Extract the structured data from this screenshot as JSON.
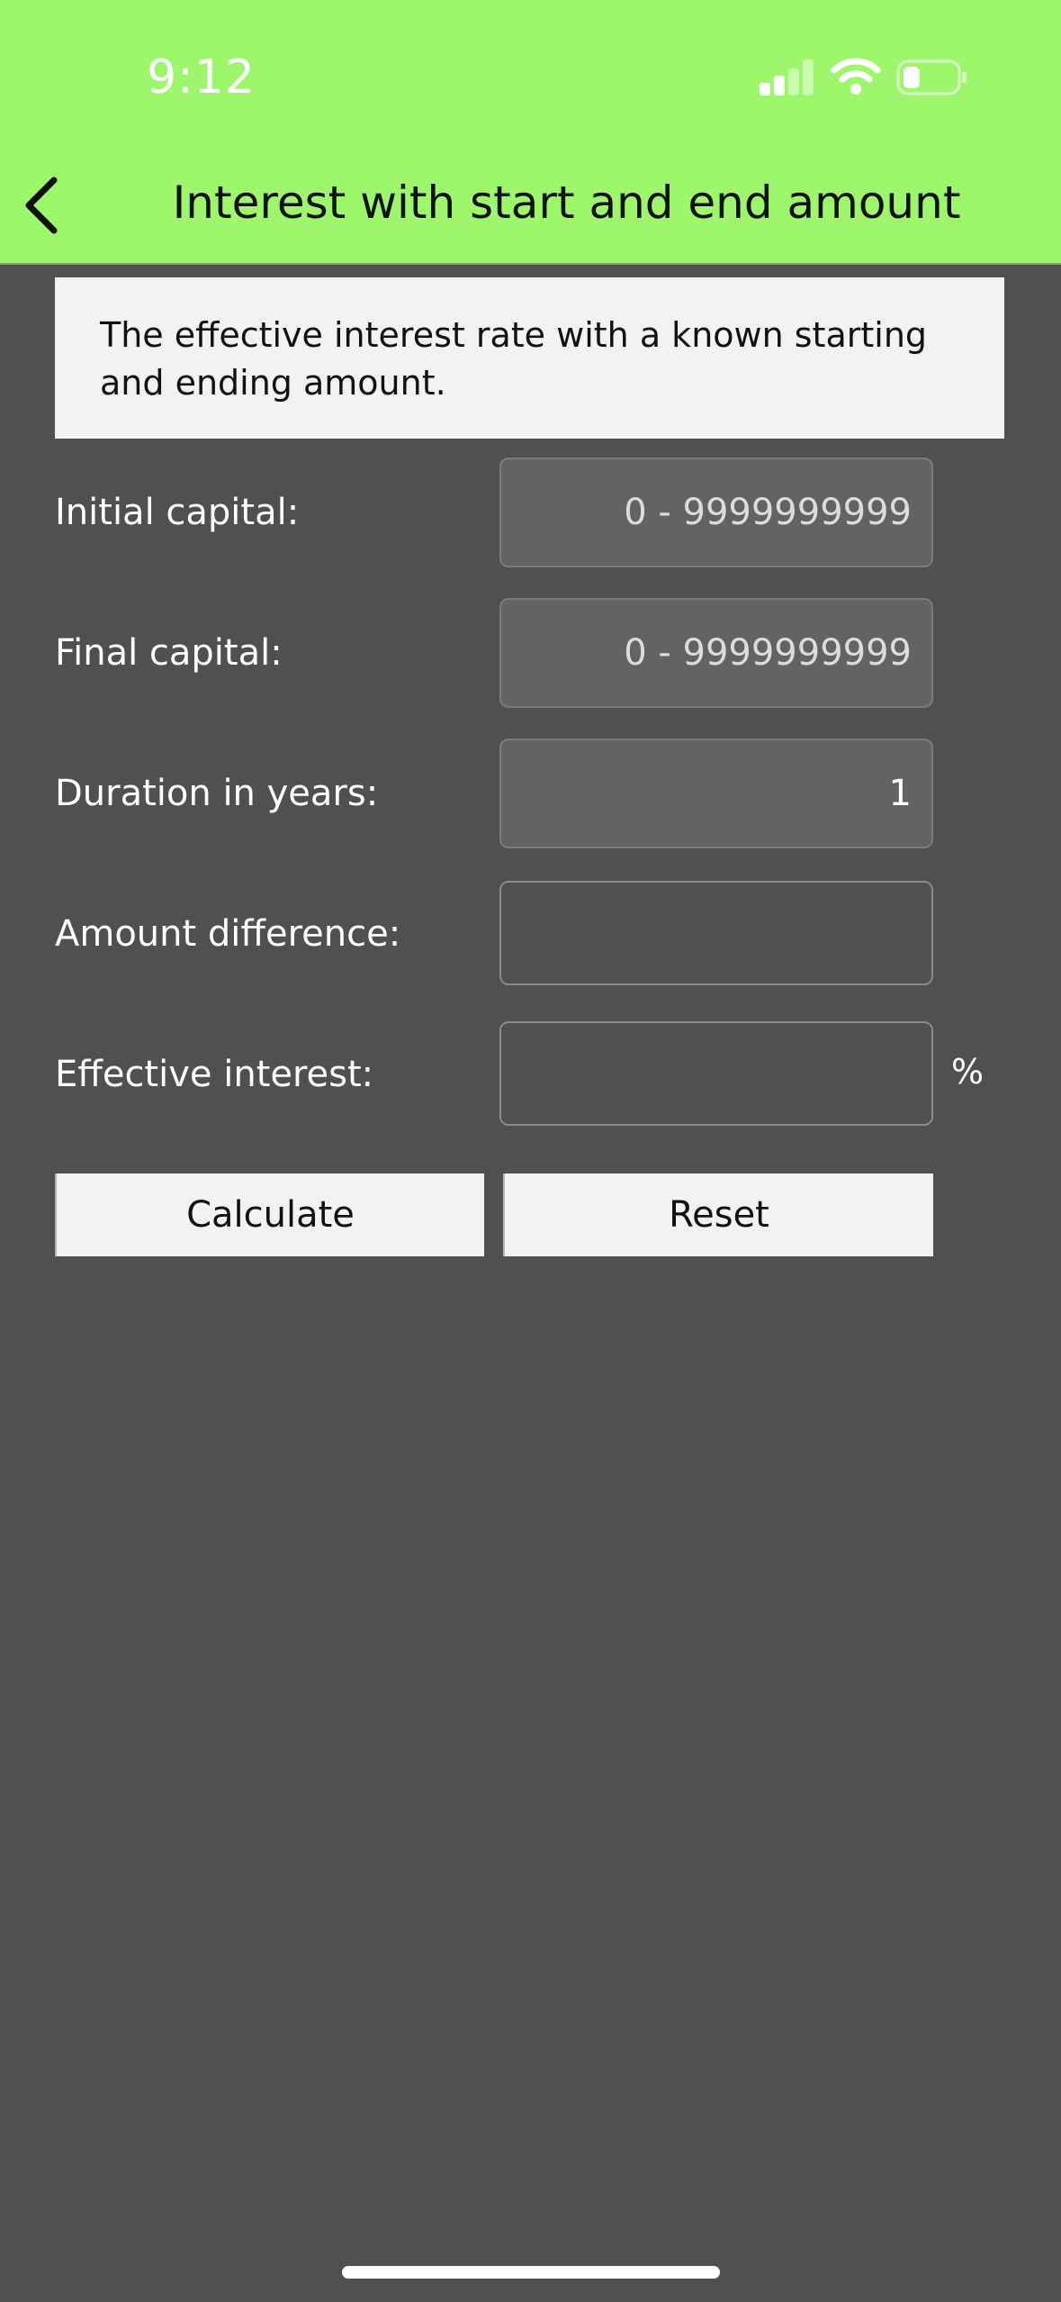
{
  "status_bar": {
    "time": "9:12",
    "icons": [
      "signal-icon",
      "wifi-icon",
      "battery-icon"
    ]
  },
  "nav": {
    "back_icon": "chevron-left-icon",
    "title": "Interest with start and end amount"
  },
  "description": "The effective interest rate with a known starting and ending amount.",
  "form": {
    "initial_capital": {
      "label": "Initial capital:",
      "placeholder": "0 - 9999999999",
      "value": ""
    },
    "final_capital": {
      "label": "Final capital:",
      "placeholder": "0 - 9999999999",
      "value": ""
    },
    "duration": {
      "label": "Duration in years:",
      "value": "1"
    },
    "amount_difference": {
      "label": "Amount difference:",
      "value": ""
    },
    "effective_interest": {
      "label": "Effective interest:",
      "value": "",
      "unit": "%"
    }
  },
  "buttons": {
    "calculate": "Calculate",
    "reset": "Reset"
  },
  "colors": {
    "header_background": "#9df66c",
    "page_background": "#505050",
    "panel_background": "#f2f2f2"
  }
}
